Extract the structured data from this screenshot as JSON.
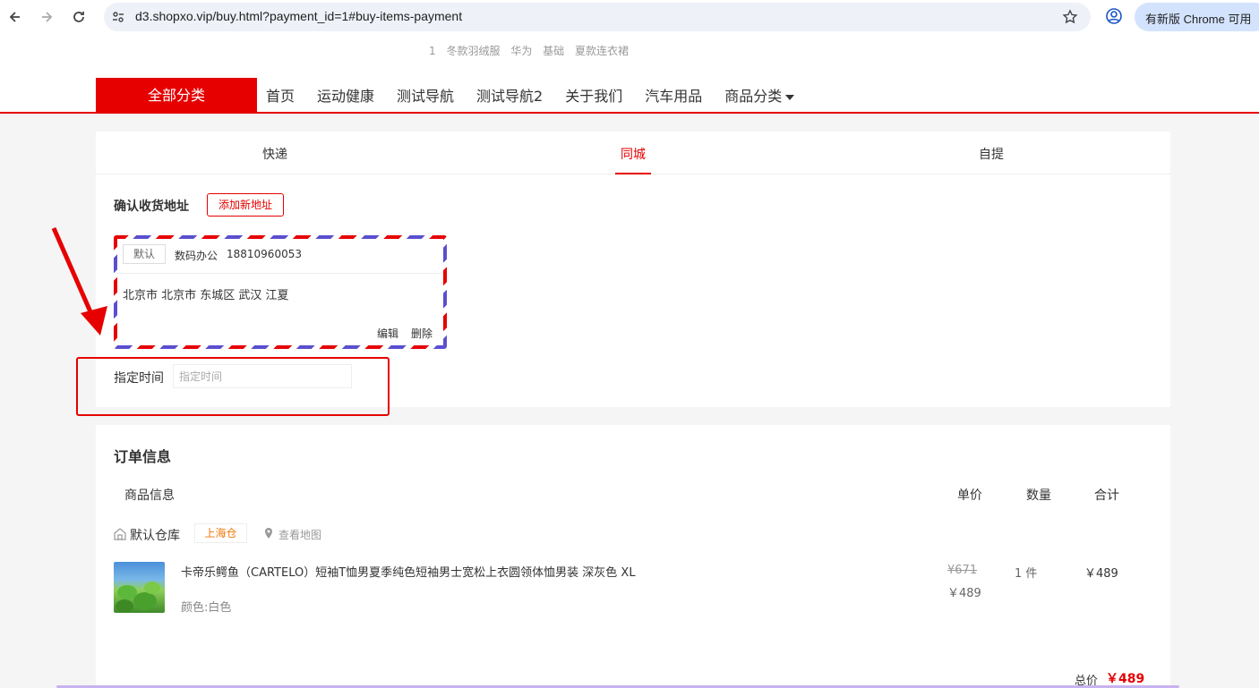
{
  "browser": {
    "url": "d3.shopxo.vip/buy.html?payment_id=1#buy-items-payment",
    "update_label": "有新版 Chrome 可用"
  },
  "header": {
    "hot_words": [
      "1",
      "冬款羽绒服",
      "华为",
      "基础",
      "夏款连衣裙"
    ],
    "category_button": "全部分类",
    "nav": [
      {
        "label": "首页"
      },
      {
        "label": "运动健康"
      },
      {
        "label": "测试导航"
      },
      {
        "label": "测试导航2"
      },
      {
        "label": "关于我们"
      },
      {
        "label": "汽车用品"
      },
      {
        "label": "商品分类"
      }
    ]
  },
  "delivery_tabs": [
    {
      "label": "快递",
      "active": false
    },
    {
      "label": "同城",
      "active": true
    },
    {
      "label": "自提",
      "active": false
    }
  ],
  "address": {
    "section_title": "确认收货地址",
    "add_button": "添加新地址",
    "card": {
      "tag": "默认",
      "name": "数码办公",
      "phone": "18810960053",
      "detail": "北京市 北京市 东城区 武汉 江夏",
      "edit": "编辑",
      "delete": "删除"
    },
    "time_label": "指定时间",
    "time_placeholder": "指定时间"
  },
  "order": {
    "title": "订单信息",
    "columns": {
      "info": "商品信息",
      "price": "单价",
      "qty": "数量",
      "total": "合计"
    },
    "warehouse": {
      "name": "默认仓库",
      "tag": "上海仓",
      "map_link": "查看地图"
    },
    "item": {
      "name": "卡帝乐鳄鱼（CARTELO）短袖T恤男夏季纯色短袖男士宽松上衣圆领体恤男装 深灰色 XL",
      "spec": "颜色:白色",
      "price_original": "¥671",
      "price_current": "￥489",
      "quantity": "1 件",
      "subtotal": "￥489"
    },
    "total_label": "总价",
    "total_value": "￥489"
  },
  "colors": {
    "accent": "#e60000",
    "tag_orange": "#f0780a"
  }
}
